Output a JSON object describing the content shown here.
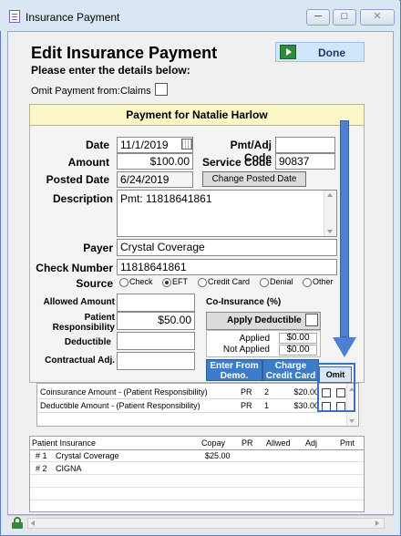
{
  "window": {
    "title": "Insurance Payment",
    "min_glyph": "─",
    "max_glyph": "□",
    "close_glyph": "✕"
  },
  "header": {
    "title": "Edit Insurance Payment",
    "subtitle": "Please enter the details below:",
    "done_label": "Done"
  },
  "omit_payment": {
    "label": "Omit Payment from:",
    "claims_label": "Claims",
    "checked": false
  },
  "panel": {
    "title": "Payment for Natalie Harlow"
  },
  "form": {
    "date_label": "Date",
    "date_value": "11/1/2019",
    "amount_label": "Amount",
    "amount_value": "$100.00",
    "posted_label": "Posted Date",
    "posted_value": "6/24/2019",
    "adj_code_label": "Pmt/Adj Code",
    "adj_code_value": "",
    "service_code_label": "Service Code",
    "service_code_value": "90837",
    "change_posted_label": "Change Posted Date",
    "description_label": "Description",
    "description_value": "Pmt: 11818641861",
    "payer_label": "Payer",
    "payer_value": "Crystal Coverage",
    "check_number_label": "Check Number",
    "check_number_value": "11818641861",
    "source_label": "Source",
    "source_options": [
      "Check",
      "EFT",
      "Credit Card",
      "Denial",
      "Other"
    ],
    "source_selected": "EFT",
    "allowed_label": "Allowed Amount",
    "allowed_value": "",
    "patient_resp_label": "Patient Responsibility",
    "patient_resp_value": "$50.00",
    "deductible_label": "Deductible",
    "deductible_value": "",
    "contractual_label": "Contractual Adj.",
    "contractual_value": ""
  },
  "coinsurance": {
    "label": "Co-Insurance (%)",
    "apply_deductible_label": "Apply Deductible",
    "applied_label": "Applied",
    "applied_value": "$0.00",
    "not_applied_label": "Not Applied",
    "not_applied_value": "$0.00"
  },
  "grid": {
    "col_enter": "Enter From Demo.",
    "col_charge": "Charge Credit Card",
    "col_omit": "Omit",
    "rows": [
      {
        "desc": "Coinsurance Amount - (Patient Responsibility)",
        "pr": "PR",
        "num": "2",
        "amount": "$20.00"
      },
      {
        "desc": "Deductible Amount - (Patient Responsibility)",
        "pr": "PR",
        "num": "1",
        "amount": "$30.00"
      }
    ]
  },
  "insurance": {
    "headers": {
      "name": "Patient Insurance",
      "copay": "Copay",
      "pr": "PR",
      "allowed": "Allwed",
      "adj": "Adj",
      "pmt": "Pmt"
    },
    "rows": [
      {
        "idx": "# 1",
        "name": "Crystal Coverage",
        "copay": "$25.00"
      },
      {
        "idx": "# 2",
        "name": "CIGNA",
        "copay": ""
      }
    ]
  },
  "colors": {
    "accent": "#3d7cc9",
    "highlight": "#4f7fd0",
    "panel_header": "#fbf6c6"
  }
}
